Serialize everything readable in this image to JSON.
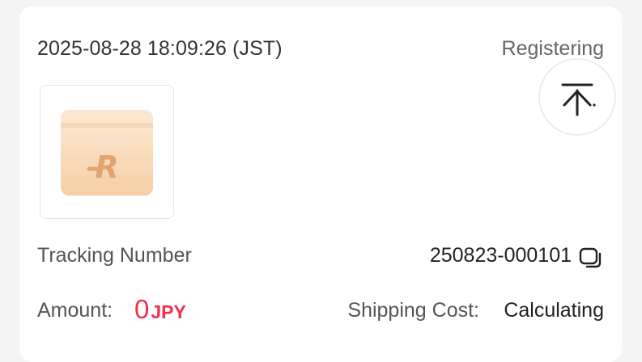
{
  "order": {
    "datetime": "2025-08-28 18:09:26 (JST)",
    "status": "Registering",
    "thumbnail_icon": "package-box-icon",
    "tracking_label": "Tracking Number",
    "tracking_number": "250823-000101",
    "amount_label": "Amount:",
    "amount_value": "0",
    "amount_currency": "JPY",
    "shipping_label": "Shipping Cost:",
    "shipping_value": "Calculating"
  },
  "controls": {
    "back_to_top_icon": "arrow-up-to-top-icon",
    "copy_icon": "copy-icon"
  },
  "colors": {
    "amount": "#f0304e",
    "box_light": "#fbe3c8",
    "box_dark": "#f5c99b"
  }
}
